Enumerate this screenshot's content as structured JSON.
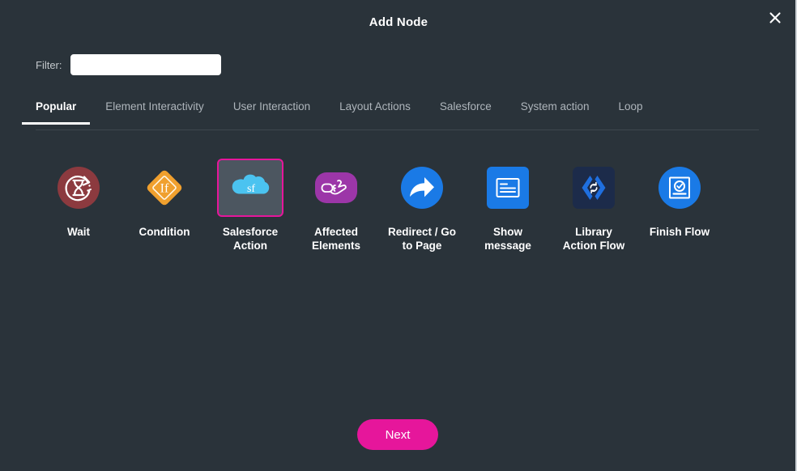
{
  "dialog": {
    "title": "Add Node",
    "close_icon": "close-icon"
  },
  "filter": {
    "label": "Filter:",
    "value": "",
    "placeholder": ""
  },
  "tabs": [
    {
      "label": "Popular",
      "active": true
    },
    {
      "label": "Element Interactivity",
      "active": false
    },
    {
      "label": "User Interaction",
      "active": false
    },
    {
      "label": "Layout Actions",
      "active": false
    },
    {
      "label": "Salesforce",
      "active": false
    },
    {
      "label": "System action",
      "active": false
    },
    {
      "label": "Loop",
      "active": false
    }
  ],
  "nodes": [
    {
      "label": "Wait",
      "icon": "wait-hourglass-icon",
      "selected": false,
      "color": "#8c3a3f"
    },
    {
      "label": "Condition",
      "icon": "condition-if-icon",
      "selected": false,
      "color": "#f0a02e"
    },
    {
      "label": "Salesforce\nAction",
      "icon": "salesforce-cloud-icon",
      "selected": true,
      "color": "#4bc3f0"
    },
    {
      "label": "Affected\nElements",
      "icon": "affected-elements-icon",
      "selected": false,
      "color": "#9c36a8"
    },
    {
      "label": "Redirect / Go\nto Page",
      "icon": "redirect-arrow-icon",
      "selected": false,
      "color": "#1a7ae6"
    },
    {
      "label": "Show\nmessage",
      "icon": "show-message-icon",
      "selected": false,
      "color": "#1a7ae6"
    },
    {
      "label": "Library\nAction Flow",
      "icon": "library-action-flow-icon",
      "selected": false,
      "color": "#1c2b4a"
    },
    {
      "label": "Finish Flow",
      "icon": "finish-flow-icon",
      "selected": false,
      "color": "#1a7ae6"
    }
  ],
  "footer": {
    "next_label": "Next"
  },
  "colors": {
    "background": "#2a333a",
    "accent": "#e6169b",
    "selected_card_bg": "#4c5660",
    "tab_active_text": "#ffffff",
    "tab_inactive_text": "#aeb5bb"
  }
}
